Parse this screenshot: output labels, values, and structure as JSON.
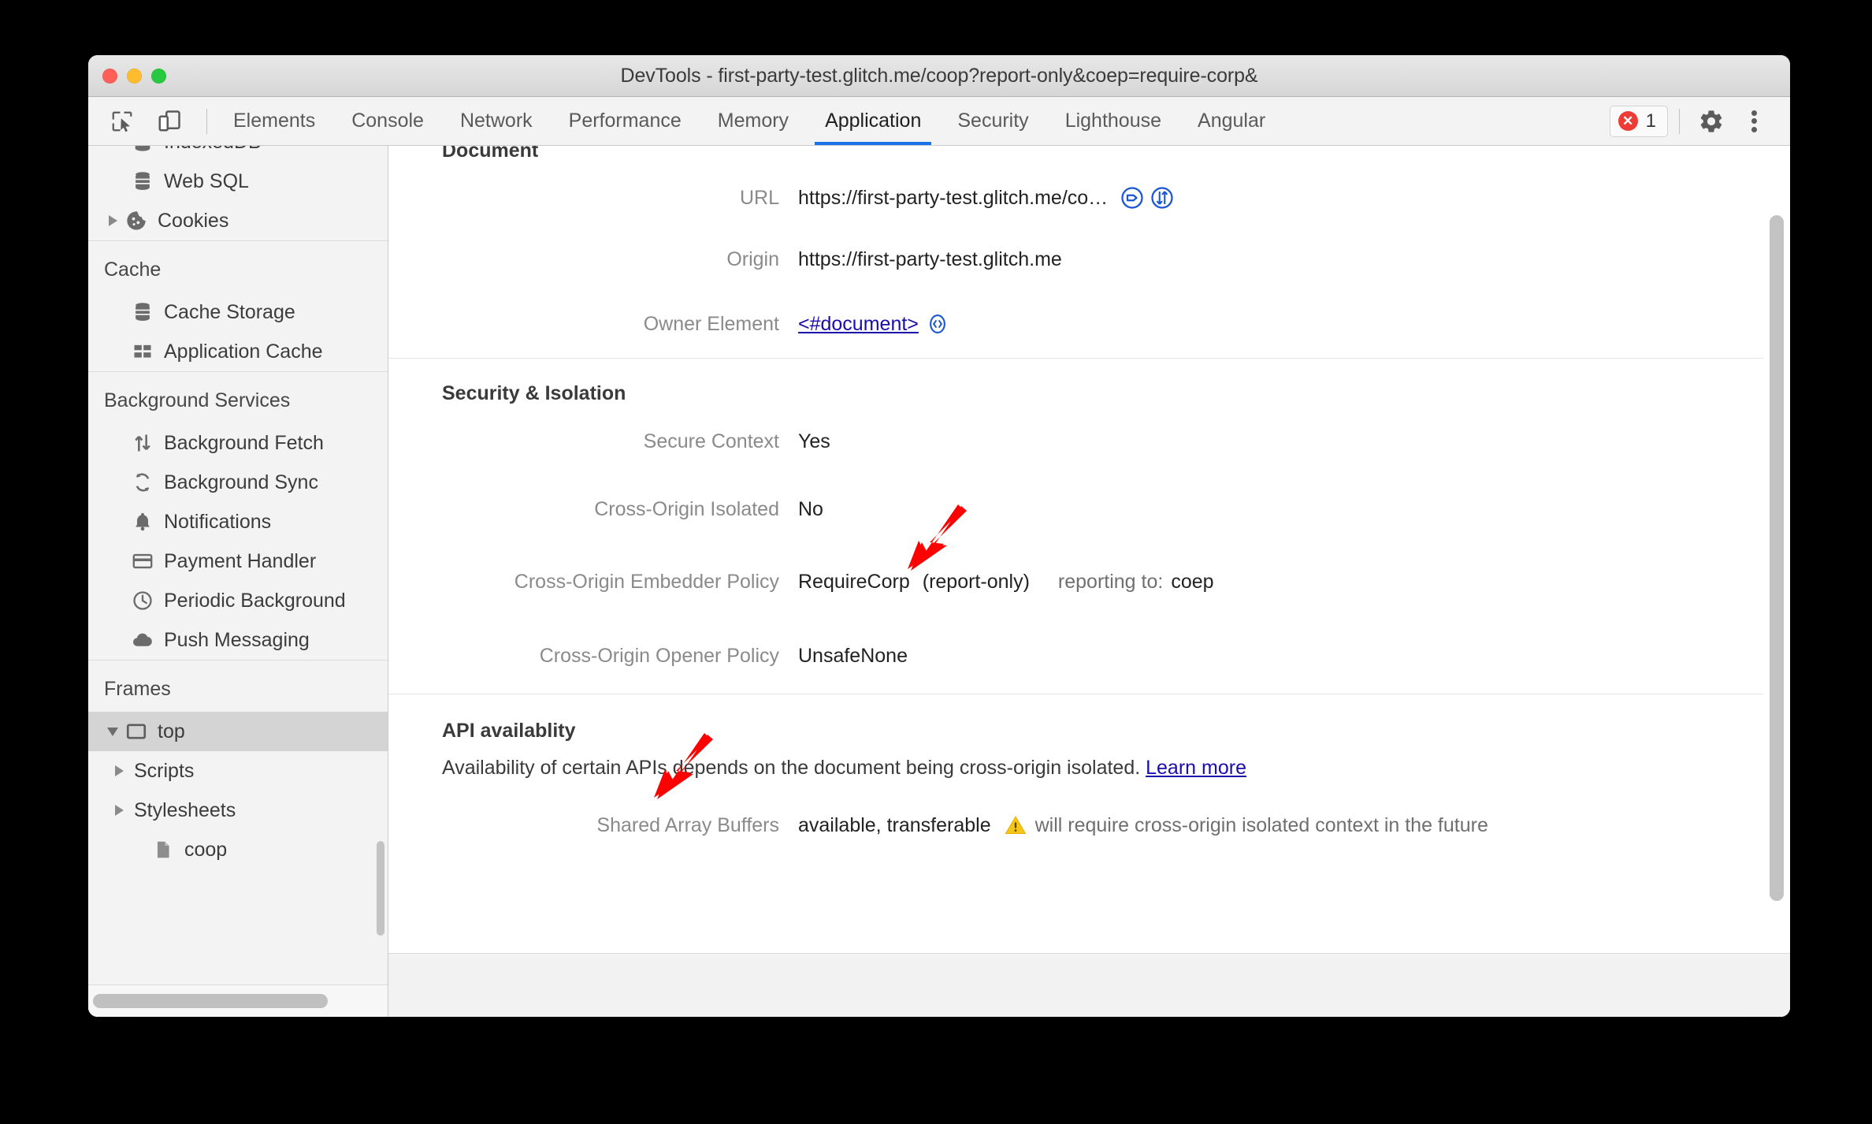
{
  "window": {
    "title": "DevTools - first-party-test.glitch.me/coop?report-only&coep=require-corp&",
    "traffic_lights": [
      "close",
      "minimize",
      "zoom"
    ]
  },
  "toolbar": {
    "inspect_icon": "inspect-element-icon",
    "device_icon": "device-toolbar-icon",
    "error_count": "1",
    "error_icon": "error-circle-icon",
    "settings_icon": "gear-icon",
    "more_icon": "kebab-menu-icon"
  },
  "tabs": [
    {
      "label": "Elements",
      "active": false
    },
    {
      "label": "Console",
      "active": false
    },
    {
      "label": "Network",
      "active": false
    },
    {
      "label": "Performance",
      "active": false
    },
    {
      "label": "Memory",
      "active": false
    },
    {
      "label": "Application",
      "active": true
    },
    {
      "label": "Security",
      "active": false
    },
    {
      "label": "Lighthouse",
      "active": false
    },
    {
      "label": "Angular",
      "active": false
    }
  ],
  "sidebar": {
    "groups": [
      {
        "title": null,
        "items": [
          {
            "label": "IndexedDB",
            "icon": "database-icon",
            "twisty": null,
            "indent": 1,
            "selected": false,
            "clipped": true
          },
          {
            "label": "Web SQL",
            "icon": "database-icon",
            "twisty": null,
            "indent": 1,
            "selected": false
          },
          {
            "label": "Cookies",
            "icon": "cookie-icon",
            "twisty": "right",
            "indent": 0,
            "selected": false
          }
        ]
      },
      {
        "title": "Cache",
        "items": [
          {
            "label": "Cache Storage",
            "icon": "database-icon",
            "twisty": null,
            "indent": 1,
            "selected": false
          },
          {
            "label": "Application Cache",
            "icon": "grid-icon",
            "twisty": null,
            "indent": 1,
            "selected": false
          }
        ]
      },
      {
        "title": "Background Services",
        "items": [
          {
            "label": "Background Fetch",
            "icon": "up-down-arrows-icon",
            "twisty": null,
            "indent": 1,
            "selected": false
          },
          {
            "label": "Background Sync",
            "icon": "sync-icon",
            "twisty": null,
            "indent": 1,
            "selected": false
          },
          {
            "label": "Notifications",
            "icon": "bell-icon",
            "twisty": null,
            "indent": 1,
            "selected": false
          },
          {
            "label": "Payment Handler",
            "icon": "credit-card-icon",
            "twisty": null,
            "indent": 1,
            "selected": false
          },
          {
            "label": "Periodic Background",
            "icon": "clock-icon",
            "twisty": null,
            "indent": 1,
            "selected": false
          },
          {
            "label": "Push Messaging",
            "icon": "cloud-icon",
            "twisty": null,
            "indent": 1,
            "selected": false
          }
        ]
      },
      {
        "title": "Frames",
        "items": [
          {
            "label": "top",
            "icon": "frame-icon",
            "twisty": "down",
            "indent": 0,
            "selected": true
          },
          {
            "label": "Scripts",
            "icon": null,
            "twisty": "right",
            "indent": 1,
            "selected": false
          },
          {
            "label": "Stylesheets",
            "icon": null,
            "twisty": "right",
            "indent": 1,
            "selected": false
          },
          {
            "label": "coop",
            "icon": "document-icon",
            "twisty": null,
            "indent": 2,
            "selected": false
          }
        ]
      }
    ]
  },
  "main": {
    "sections": [
      {
        "heading": "Document",
        "heading_clipped": true,
        "rows": [
          {
            "key": "URL",
            "value": "https://first-party-test.glitch.me/co…",
            "icons": [
              "tag-icon",
              "network-jump-icon"
            ]
          },
          {
            "key": "Origin",
            "value": "https://first-party-test.glitch.me",
            "icons": []
          },
          {
            "key": "Owner Element",
            "value": "<#document>",
            "link": true,
            "icons": [
              "code-icon"
            ]
          }
        ]
      },
      {
        "heading": "Security & Isolation",
        "rows": [
          {
            "key": "Secure Context",
            "value": "Yes",
            "icons": []
          },
          {
            "key": "Cross-Origin Isolated",
            "value": "No",
            "icons": []
          },
          {
            "key": "Cross-Origin Embedder Policy",
            "value": "RequireCorp",
            "extra": "(report-only)",
            "reporting_label": "reporting to:",
            "reporting_value": "coep",
            "icons": []
          },
          {
            "key": "Cross-Origin Opener Policy",
            "value": "UnsafeNone",
            "icons": []
          }
        ]
      },
      {
        "heading": "API availablity",
        "note": "Availability of certain APIs depends on the document being cross-origin isolated.",
        "note_link": "Learn more",
        "rows": [
          {
            "key": "Shared Array Buffers",
            "value": "available, transferable",
            "warn_icon": "warning-triangle-icon",
            "warn_text": "will require cross-origin isolated context in the future",
            "icons": []
          }
        ]
      }
    ]
  },
  "annotations": {
    "arrow_color": "#FF0000",
    "arrows": [
      {
        "name": "arrow-to-cross-origin-isolated",
        "target": "Cross-Origin Isolated value"
      },
      {
        "name": "arrow-to-api-availability",
        "target": "API availablity heading"
      }
    ]
  }
}
